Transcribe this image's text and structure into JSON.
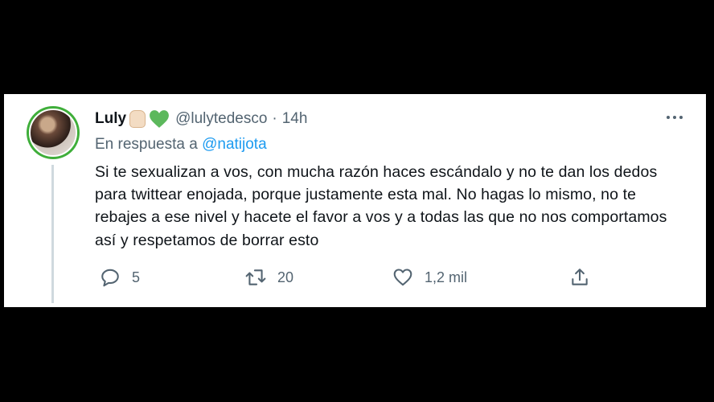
{
  "tweet": {
    "display_name": "Luly",
    "handle": "@lulytedesco",
    "separator": "·",
    "time": "14h",
    "reply_prefix": "En respuesta a",
    "reply_mention": "@natijota",
    "text": "Si te sexualizan a vos, con mucha razón haces escándalo y no te dan los dedos para twittear enojada, porque justamente esta mal. No hagas lo mismo, no te rebajes a ese nivel y hacete el favor a vos y a todas las que no nos comportamos así y respetamos de borrar esto",
    "emoji": [
      "raised-fist-icon",
      "green-heart-icon"
    ]
  },
  "actions": {
    "reply_count": "5",
    "retweet_count": "20",
    "like_count": "1,2 mil"
  },
  "colors": {
    "background": "#000000",
    "card": "#ffffff",
    "secondary_text": "#536471",
    "link": "#1d9bf0",
    "avatar_ring": "#3fae3a",
    "heart": "#5cb85c"
  }
}
